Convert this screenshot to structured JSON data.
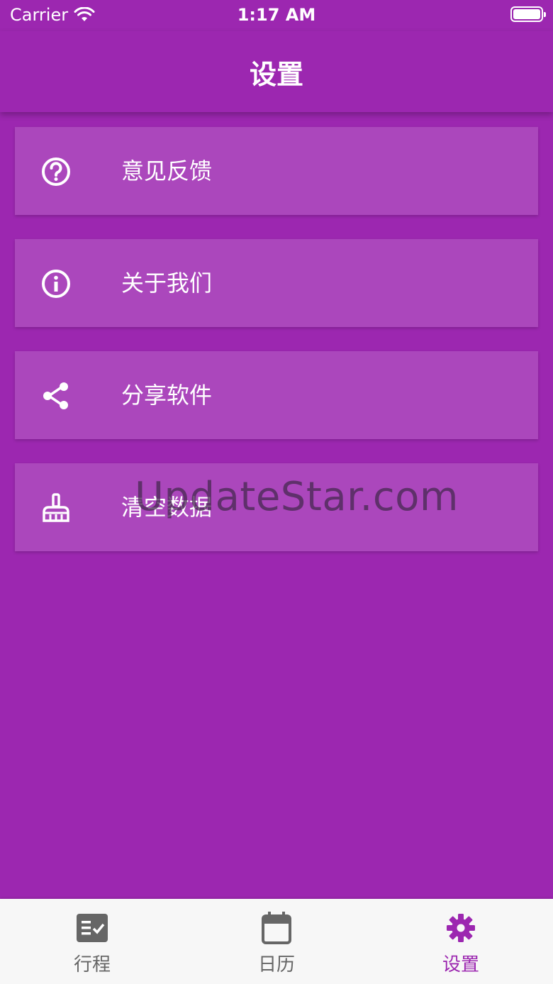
{
  "status_bar": {
    "carrier": "Carrier",
    "time": "1:17 AM"
  },
  "app_bar": {
    "title": "设置"
  },
  "settings": [
    {
      "label": "意见反馈",
      "icon": "help-circle-icon"
    },
    {
      "label": "关于我们",
      "icon": "info-circle-icon"
    },
    {
      "label": "分享软件",
      "icon": "share-icon"
    },
    {
      "label": "清空数据",
      "icon": "broom-icon"
    }
  ],
  "watermark": "UpdateStar.com",
  "bottom_nav": {
    "items": [
      {
        "label": "行程",
        "icon": "checklist-icon",
        "active": false
      },
      {
        "label": "日历",
        "icon": "calendar-icon",
        "active": false
      },
      {
        "label": "设置",
        "icon": "gear-icon",
        "active": true
      }
    ]
  },
  "colors": {
    "primary": "#9c27b0",
    "item_background": "#ab47bc",
    "nav_background": "#f7f7f7",
    "nav_inactive": "#666666"
  }
}
